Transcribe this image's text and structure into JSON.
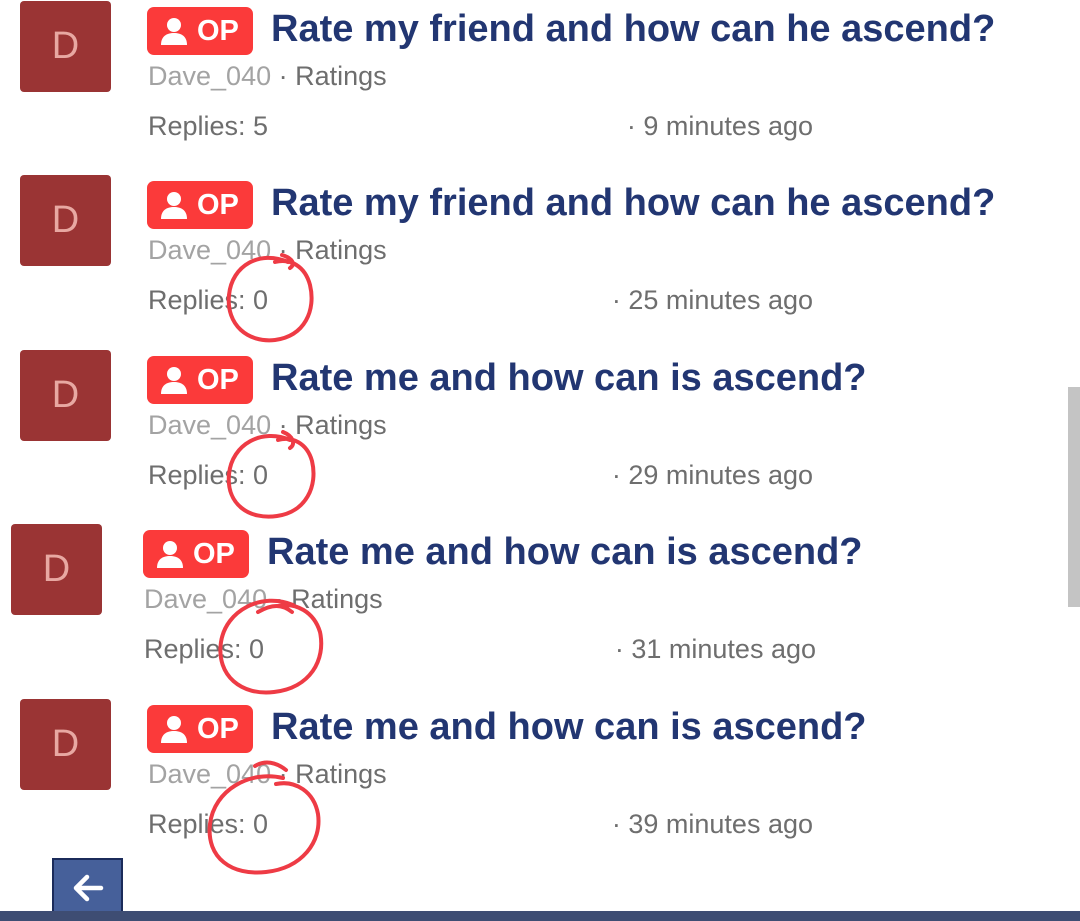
{
  "accent_colors": {
    "title": "#223672",
    "op_badge": "#fb3a3a",
    "avatar": "#9a3434",
    "annotation": "#ee3b45"
  },
  "threads": [
    {
      "avatar_letter": "D",
      "op_label": "OP",
      "title": "Rate my friend and how can he ascend?",
      "author": "Dave_040",
      "separator": " · ",
      "category": "Ratings",
      "replies": "Replies: 5",
      "time": "· 9 minutes ago"
    },
    {
      "avatar_letter": "D",
      "op_label": "OP",
      "title": "Rate my friend and how can he ascend?",
      "author": "Dave_040",
      "separator": " · ",
      "category": "Ratings",
      "replies": "Replies: 0",
      "time": "· 25 minutes ago"
    },
    {
      "avatar_letter": "D",
      "op_label": "OP",
      "title": "Rate me and how can is ascend?",
      "author": "Dave_040",
      "separator": " · ",
      "category": "Ratings",
      "replies": "Replies: 0",
      "time": "· 29 minutes ago"
    },
    {
      "avatar_letter": "D",
      "op_label": "OP",
      "title": "Rate me and how can is ascend?",
      "author": "Dave_040",
      "separator": " · ",
      "category": "Ratings",
      "replies": "Replies: 0",
      "time": "· 31 minutes ago"
    },
    {
      "avatar_letter": "D",
      "op_label": "OP",
      "title": "Rate me and how can is ascend?",
      "author": "Dave_040",
      "separator": " · ",
      "category": "Ratings",
      "replies": "Replies: 0",
      "time": "· 39 minutes ago"
    }
  ],
  "icons": {
    "op_badge_icon": "user-icon",
    "back_button_icon": "arrow-left-icon"
  }
}
